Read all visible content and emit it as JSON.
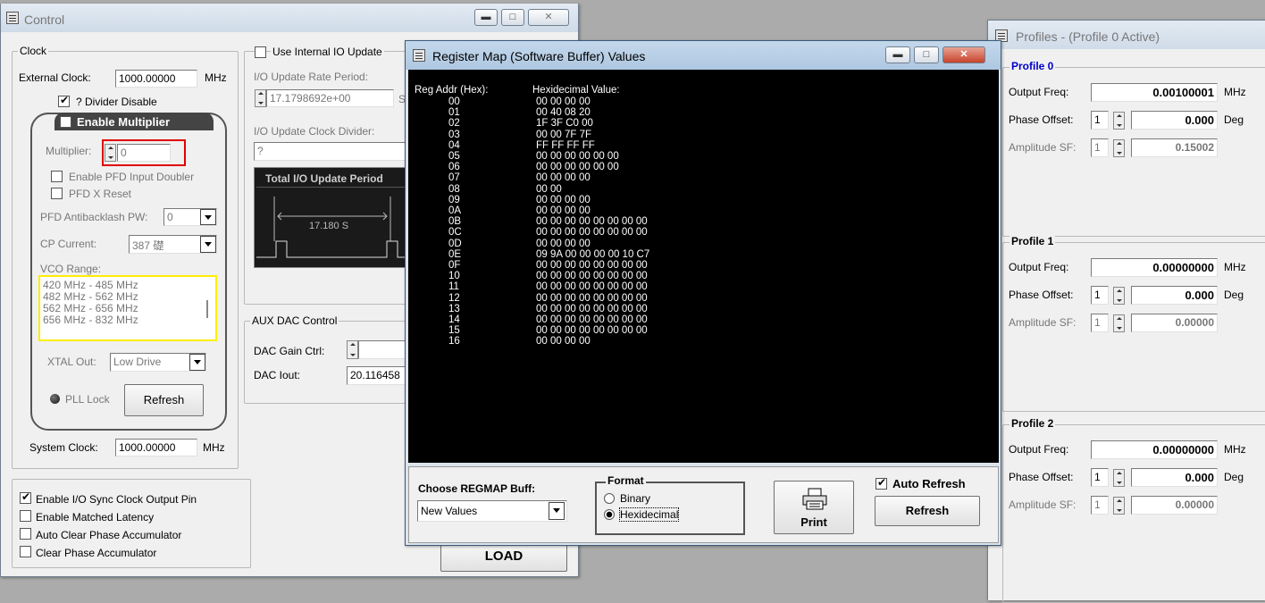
{
  "control": {
    "title": "Control",
    "clock": {
      "group_label": "Clock",
      "external_clock_label": "External Clock:",
      "external_clock_value": "1000.00000",
      "mhz": "MHz",
      "divider_disable_label": "? Divider Disable",
      "enable_multiplier_label": "Enable Multiplier",
      "multiplier_label": "Multiplier:",
      "multiplier_value": "0",
      "pfd_doubler_label": "Enable PFD Input Doubler",
      "pfd_reset_label": "PFD X Reset",
      "pfd_antibacklash_label": "PFD Antibacklash PW:",
      "pfd_antibacklash_value": "0",
      "cp_current_label": "CP Current:",
      "cp_current_value": "387 礎",
      "vco_range_label": "VCO Range:",
      "vco_ranges": [
        "420 MHz - 485 MHz",
        "482 MHz - 562 MHz",
        "562 MHz - 656 MHz",
        "656 MHz - 832 MHz"
      ],
      "xtal_out_label": "XTAL Out:",
      "xtal_out_value": "Low Drive",
      "pll_lock_label": "PLL Lock",
      "refresh_label": "Refresh",
      "system_clock_label": "System Clock:",
      "system_clock_value": "1000.00000"
    },
    "io": {
      "use_internal_label": "Use Internal IO Update",
      "rate_period_label": "I/O Update Rate Period:",
      "rate_period_value": "17.1798692e+00",
      "rate_period_unit_partial": "S",
      "clock_divider_label": "I/O Update Clock Divider:",
      "clock_divider_value": "?",
      "total_period_label": "Total I/O Update Period",
      "period_value": "17.180 S"
    },
    "aux_dac": {
      "group_label": "AUX DAC Control",
      "gain_label": "DAC Gain Ctrl:",
      "iout_label": "DAC Iout:",
      "iout_value": "20.116458"
    },
    "options": [
      {
        "label": "Enable I/O Sync Clock Output Pin",
        "checked": true
      },
      {
        "label": "Enable Matched Latency",
        "checked": false
      },
      {
        "label": "Auto Clear Phase Accumulator",
        "checked": false
      },
      {
        "label": "Clear Phase Accumulator",
        "checked": false
      }
    ],
    "load_label": "LOAD"
  },
  "regmap": {
    "title": "Register Map (Software Buffer) Values",
    "addr_header": "Reg Addr (Hex):",
    "value_header": "Hexidecimal Value:",
    "rows": [
      {
        "addr": "00",
        "value": "00 00 00 00"
      },
      {
        "addr": "01",
        "value": "00 40 08 20"
      },
      {
        "addr": "02",
        "value": "1F 3F C0 00"
      },
      {
        "addr": "03",
        "value": "00 00 7F 7F"
      },
      {
        "addr": "04",
        "value": "FF FF FF FF"
      },
      {
        "addr": "05",
        "value": "00 00 00 00 00 00"
      },
      {
        "addr": "06",
        "value": "00 00 00 00 00 00"
      },
      {
        "addr": "07",
        "value": "00 00 00 00"
      },
      {
        "addr": "08",
        "value": "00 00"
      },
      {
        "addr": "09",
        "value": "00 00 00 00"
      },
      {
        "addr": "0A",
        "value": "00 00 00 00"
      },
      {
        "addr": "0B",
        "value": "00 00 00 00 00 00 00 00"
      },
      {
        "addr": "0C",
        "value": "00 00 00 00 00 00 00 00"
      },
      {
        "addr": "0D",
        "value": "00 00 00 00"
      },
      {
        "addr": "0E",
        "value": "09 9A 00 00 00 00 10 C7"
      },
      {
        "addr": "0F",
        "value": "00 00 00 00 00 00 00 00"
      },
      {
        "addr": "10",
        "value": "00 00 00 00 00 00 00 00"
      },
      {
        "addr": "11",
        "value": "00 00 00 00 00 00 00 00"
      },
      {
        "addr": "12",
        "value": "00 00 00 00 00 00 00 00"
      },
      {
        "addr": "13",
        "value": "00 00 00 00 00 00 00 00"
      },
      {
        "addr": "14",
        "value": "00 00 00 00 00 00 00 00"
      },
      {
        "addr": "15",
        "value": "00 00 00 00 00 00 00 00"
      },
      {
        "addr": "16",
        "value": "00 00 00 00"
      }
    ],
    "choose_label": "Choose REGMAP Buff:",
    "choose_value": "New Values",
    "format_label": "Format",
    "format_binary": "Binary",
    "format_hex": "Hexidecimal",
    "print_label": "Print",
    "auto_refresh_label": "Auto Refresh",
    "refresh_label": "Refresh"
  },
  "profiles": {
    "title": "Profiles - (Profile 0 Active)",
    "output_freq_label": "Output Freq:",
    "phase_offset_label": "Phase Offset:",
    "amplitude_label": "Amplitude SF:",
    "mhz": "MHz",
    "deg": "Deg",
    "items": [
      {
        "name": "Profile 0",
        "freq": "0.00100001",
        "phase_step": "1",
        "phase": "0.000",
        "amp_step": "1",
        "amp": "0.15002"
      },
      {
        "name": "Profile 1",
        "freq": "0.00000000",
        "phase_step": "1",
        "phase": "0.000",
        "amp_step": "1",
        "amp": "0.00000"
      },
      {
        "name": "Profile 2",
        "freq": "0.00000000",
        "phase_step": "1",
        "phase": "0.000",
        "amp_step": "1",
        "amp": "0.00000"
      }
    ]
  },
  "colors": {
    "accent_blue": "#0000cc",
    "highlight_red": "#e00000",
    "highlight_yellow": "#ffee00",
    "console_bg": "#000000"
  }
}
